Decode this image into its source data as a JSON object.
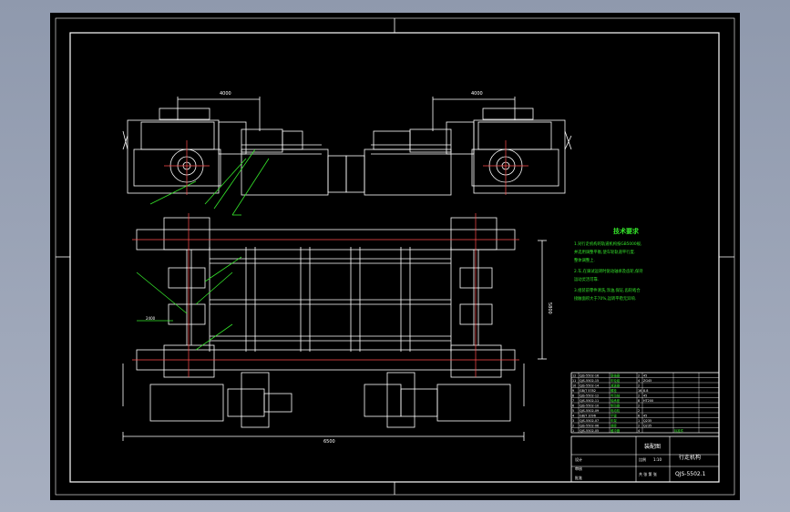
{
  "drawing": {
    "tech_requirements": {
      "title": "技术要求",
      "lines": [
        "1.对行走机构的轨道机构按GB5000规,",
        "  并选用调整平衡,使车轮轨道平行度.",
        "  整体调整上.",
        "2.车,在调试运转时驱动轴承及齿轮,保持",
        "  运动灵活可靠.",
        "3.组装前零件清洗,涂油,保证,齿轮啮合",
        "  接触面积大于70%,运转平稳无异响."
      ]
    },
    "parts_table": {
      "rows": [
        [
          "12",
          "QJS-5502-16",
          "联轴器",
          "2",
          "45",
          "",
          ""
        ],
        [
          "11",
          "QJS-5502-15",
          "车轮组",
          "4",
          "ZG45",
          "",
          ""
        ],
        [
          "10",
          "QJS-5502-14",
          "减速器",
          "2",
          "",
          "",
          ""
        ],
        [
          "9",
          "GB/T 5782",
          "螺栓",
          "16",
          "8.8",
          "",
          ""
        ],
        [
          "8",
          "QJS-5502-12",
          "传动轴",
          "2",
          "45",
          "",
          ""
        ],
        [
          "7",
          "QJS-5502-11",
          "轴承座",
          "8",
          "HT200",
          "",
          ""
        ],
        [
          "6",
          "QJS-5502-10",
          "制动器",
          "2",
          "",
          "",
          ""
        ],
        [
          "5",
          "QJS-5502-09",
          "电动机",
          "2",
          "",
          "",
          ""
        ],
        [
          "4",
          "GB/T 1096",
          "平键",
          "8",
          "45",
          "",
          ""
        ],
        [
          "3",
          "QJS-5502-07",
          "车架",
          "1",
          "Q235",
          "",
          ""
        ],
        [
          "2",
          "QJS-5502-06",
          "端梁",
          "2",
          "Q235",
          "",
          ""
        ],
        [
          "1",
          "QJS-5502-05",
          "缓冲器",
          "4",
          "",
          "标准件",
          ""
        ]
      ]
    },
    "title_block": {
      "part_name": "行走机构",
      "drawing_no": "QJS-5502.1",
      "company": "装配图",
      "scale_label": "比例",
      "scale": "1:10",
      "sheet_label": "共 张 第 张",
      "designer_label": "设计",
      "checker_label": "审核",
      "approver_label": "批准"
    },
    "dimensions": {
      "track_gauge": "5800",
      "wheel_base": "4000",
      "side_dim": "2400",
      "overall": "6500"
    }
  }
}
